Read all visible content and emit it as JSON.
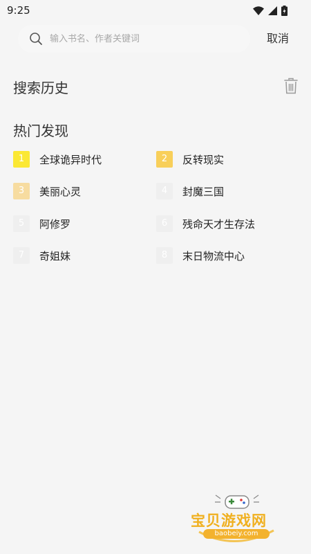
{
  "status_bar": {
    "time": "9:25"
  },
  "search": {
    "placeholder": "输入书名、作者关键词",
    "value": "",
    "cancel_label": "取消"
  },
  "history": {
    "title": "搜索历史"
  },
  "hot": {
    "title": "热门发现",
    "items": [
      {
        "rank": "1",
        "title": "全球诡异时代",
        "badge_color": "#fbe834"
      },
      {
        "rank": "2",
        "title": "反转现实",
        "badge_color": "#f8cf5a"
      },
      {
        "rank": "3",
        "title": "美丽心灵",
        "badge_color": "#f7dca0"
      },
      {
        "rank": "4",
        "title": "封魔三国",
        "badge_color": "#efefef"
      },
      {
        "rank": "5",
        "title": "阿修罗",
        "badge_color": "#efefef"
      },
      {
        "rank": "6",
        "title": "残命天才生存法",
        "badge_color": "#efefef"
      },
      {
        "rank": "7",
        "title": "奇姐妹",
        "badge_color": "#efefef"
      },
      {
        "rank": "8",
        "title": "末日物流中心",
        "badge_color": "#efefef"
      }
    ]
  },
  "watermark": {
    "name": "宝贝游戏网",
    "url": "baobeiy.com"
  }
}
